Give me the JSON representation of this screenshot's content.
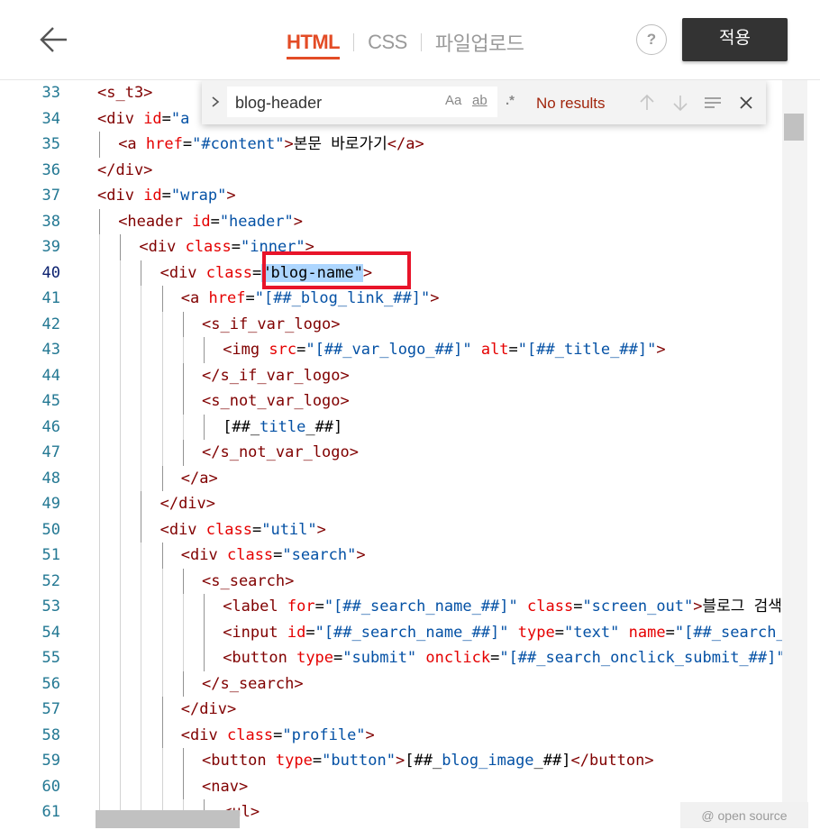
{
  "header": {
    "tabs": [
      {
        "label": "HTML",
        "active": true
      },
      {
        "label": "CSS",
        "active": false
      },
      {
        "label": "파일업로드",
        "active": false
      }
    ],
    "help_label": "?",
    "apply_label": "적용"
  },
  "find_widget": {
    "query": "blog-header",
    "match_case_label": "Aa",
    "whole_word_label": "ab",
    "regex_label": ".*",
    "status": "No results"
  },
  "badge": "@ open source",
  "colors": {
    "accent": "#e34c26",
    "apply_bg": "#333333",
    "highlight_box": "#e8142a"
  },
  "editor": {
    "lines": [
      {
        "n": 33,
        "indent": 0,
        "parts": [
          [
            "tag",
            "<s_t3>"
          ]
        ]
      },
      {
        "n": 34,
        "indent": 0,
        "parts": [
          [
            "tag",
            "<div "
          ],
          [
            "attr",
            "id"
          ],
          [
            "txt",
            "="
          ],
          [
            "val",
            "\"a"
          ]
        ]
      },
      {
        "n": 35,
        "indent": 1,
        "parts": [
          [
            "tag",
            "<a "
          ],
          [
            "attr",
            "href"
          ],
          [
            "txt",
            "="
          ],
          [
            "val",
            "\"#content\""
          ],
          [
            "tag",
            ">"
          ],
          [
            "txt",
            "본문 바로가기"
          ],
          [
            "tag",
            "</a>"
          ]
        ]
      },
      {
        "n": 36,
        "indent": 0,
        "parts": [
          [
            "tag",
            "</div>"
          ]
        ]
      },
      {
        "n": 37,
        "indent": 0,
        "parts": [
          [
            "tag",
            "<div "
          ],
          [
            "attr",
            "id"
          ],
          [
            "txt",
            "="
          ],
          [
            "val",
            "\"wrap\""
          ],
          [
            "tag",
            ">"
          ]
        ]
      },
      {
        "n": 38,
        "indent": 1,
        "parts": [
          [
            "tag",
            "<header "
          ],
          [
            "attr",
            "id"
          ],
          [
            "txt",
            "="
          ],
          [
            "val",
            "\"header\""
          ],
          [
            "tag",
            ">"
          ]
        ]
      },
      {
        "n": 39,
        "indent": 2,
        "parts": [
          [
            "tag",
            "<div "
          ],
          [
            "attr",
            "class"
          ],
          [
            "txt",
            "="
          ],
          [
            "val",
            "\"inner\""
          ],
          [
            "tag",
            ">"
          ]
        ]
      },
      {
        "n": 40,
        "indent": 3,
        "parts": [
          [
            "tag",
            "<div "
          ],
          [
            "attr",
            "class"
          ],
          [
            "txt",
            "="
          ],
          [
            "hl",
            "\"blog-name\""
          ],
          [
            "tag",
            ">"
          ]
        ]
      },
      {
        "n": 41,
        "indent": 4,
        "parts": [
          [
            "tag",
            "<a "
          ],
          [
            "attr",
            "href"
          ],
          [
            "txt",
            "="
          ],
          [
            "val",
            "\"[##_blog_link_##]\""
          ],
          [
            "tag",
            ">"
          ]
        ]
      },
      {
        "n": 42,
        "indent": 5,
        "parts": [
          [
            "tag",
            "<s_if_var_logo>"
          ]
        ]
      },
      {
        "n": 43,
        "indent": 6,
        "parts": [
          [
            "tag",
            "<img "
          ],
          [
            "attr",
            "src"
          ],
          [
            "txt",
            "="
          ],
          [
            "val",
            "\"[##_var_logo_##]\""
          ],
          [
            "txt",
            " "
          ],
          [
            "attr",
            "alt"
          ],
          [
            "txt",
            "="
          ],
          [
            "val",
            "\"[##_title_##]\""
          ],
          [
            "tag",
            ">"
          ]
        ]
      },
      {
        "n": 44,
        "indent": 5,
        "parts": [
          [
            "tag",
            "</s_if_var_logo>"
          ]
        ]
      },
      {
        "n": 45,
        "indent": 5,
        "parts": [
          [
            "tag",
            "<s_not_var_logo>"
          ]
        ]
      },
      {
        "n": 46,
        "indent": 6,
        "parts": [
          [
            "txt",
            "[##_"
          ],
          [
            "val",
            "title"
          ],
          [
            "txt",
            "_##]"
          ]
        ]
      },
      {
        "n": 47,
        "indent": 5,
        "parts": [
          [
            "tag",
            "</s_not_var_logo>"
          ]
        ]
      },
      {
        "n": 48,
        "indent": 4,
        "parts": [
          [
            "tag",
            "</a>"
          ]
        ]
      },
      {
        "n": 49,
        "indent": 3,
        "parts": [
          [
            "tag",
            "</div>"
          ]
        ]
      },
      {
        "n": 50,
        "indent": 3,
        "parts": [
          [
            "tag",
            "<div "
          ],
          [
            "attr",
            "class"
          ],
          [
            "txt",
            "="
          ],
          [
            "val",
            "\"util\""
          ],
          [
            "tag",
            ">"
          ]
        ]
      },
      {
        "n": 51,
        "indent": 4,
        "parts": [
          [
            "tag",
            "<div "
          ],
          [
            "attr",
            "class"
          ],
          [
            "txt",
            "="
          ],
          [
            "val",
            "\"search\""
          ],
          [
            "tag",
            ">"
          ]
        ]
      },
      {
        "n": 52,
        "indent": 5,
        "parts": [
          [
            "tag",
            "<s_search>"
          ]
        ]
      },
      {
        "n": 53,
        "indent": 6,
        "parts": [
          [
            "tag",
            "<label "
          ],
          [
            "attr",
            "for"
          ],
          [
            "txt",
            "="
          ],
          [
            "val",
            "\"[##_search_name_##]\""
          ],
          [
            "txt",
            " "
          ],
          [
            "attr",
            "class"
          ],
          [
            "txt",
            "="
          ],
          [
            "val",
            "\"screen_out\""
          ],
          [
            "tag",
            ">"
          ],
          [
            "txt",
            "블로그 검색"
          ]
        ]
      },
      {
        "n": 54,
        "indent": 6,
        "parts": [
          [
            "tag",
            "<input "
          ],
          [
            "attr",
            "id"
          ],
          [
            "txt",
            "="
          ],
          [
            "val",
            "\"[##_search_name_##]\""
          ],
          [
            "txt",
            " "
          ],
          [
            "attr",
            "type"
          ],
          [
            "txt",
            "="
          ],
          [
            "val",
            "\"text\""
          ],
          [
            "txt",
            " "
          ],
          [
            "attr",
            "name"
          ],
          [
            "txt",
            "="
          ],
          [
            "val",
            "\"[##_search_name_##]\""
          ]
        ]
      },
      {
        "n": 55,
        "indent": 6,
        "parts": [
          [
            "tag",
            "<button "
          ],
          [
            "attr",
            "type"
          ],
          [
            "txt",
            "="
          ],
          [
            "val",
            "\"submit\""
          ],
          [
            "txt",
            " "
          ],
          [
            "attr",
            "onclick"
          ],
          [
            "txt",
            "="
          ],
          [
            "val",
            "\"[##_search_onclick_submit_##]\""
          ]
        ]
      },
      {
        "n": 56,
        "indent": 5,
        "parts": [
          [
            "tag",
            "</s_search>"
          ]
        ]
      },
      {
        "n": 57,
        "indent": 4,
        "parts": [
          [
            "tag",
            "</div>"
          ]
        ]
      },
      {
        "n": 58,
        "indent": 4,
        "parts": [
          [
            "tag",
            "<div "
          ],
          [
            "attr",
            "class"
          ],
          [
            "txt",
            "="
          ],
          [
            "val",
            "\"profile\""
          ],
          [
            "tag",
            ">"
          ]
        ]
      },
      {
        "n": 59,
        "indent": 5,
        "parts": [
          [
            "tag",
            "<button "
          ],
          [
            "attr",
            "type"
          ],
          [
            "txt",
            "="
          ],
          [
            "val",
            "\"button\""
          ],
          [
            "tag",
            ">"
          ],
          [
            "txt",
            "[##_"
          ],
          [
            "val",
            "blog_image"
          ],
          [
            "txt",
            "_##]"
          ],
          [
            "tag",
            "</button>"
          ]
        ]
      },
      {
        "n": 60,
        "indent": 5,
        "parts": [
          [
            "tag",
            "<nav>"
          ]
        ]
      },
      {
        "n": 61,
        "indent": 6,
        "parts": [
          [
            "tag",
            "<ul>"
          ]
        ]
      }
    ],
    "current_line": 40
  }
}
